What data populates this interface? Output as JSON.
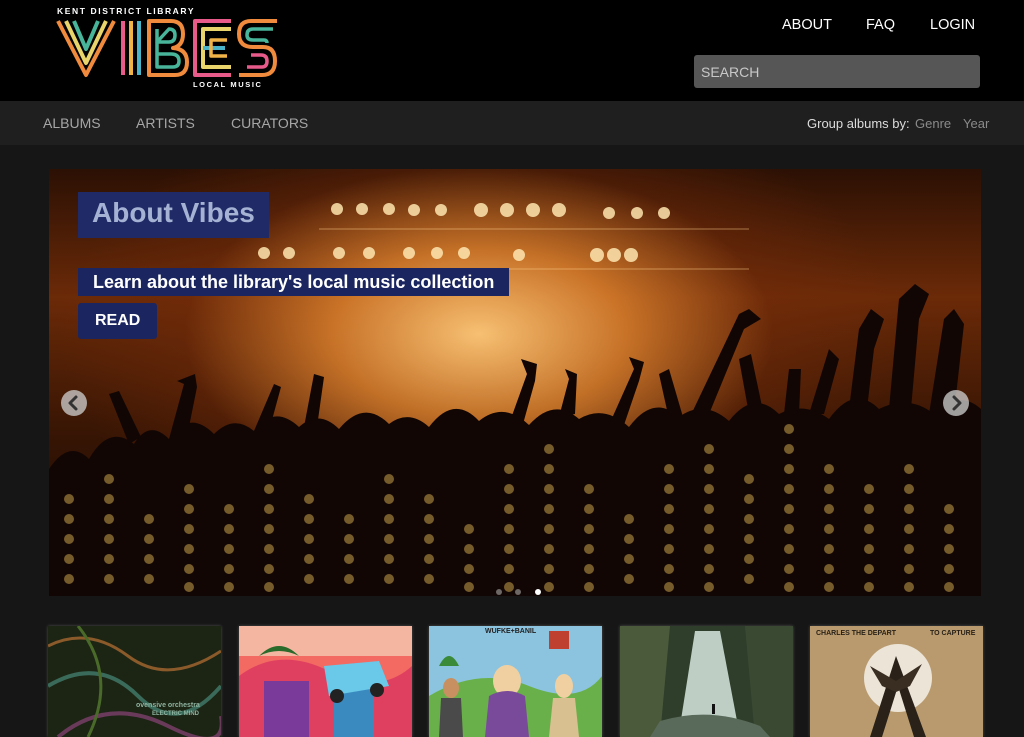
{
  "header": {
    "logo": {
      "top_text": "KENT DISTRICT LIBRARY",
      "main_text": "VIBES",
      "bottom_text": "LOCAL MUSIC"
    },
    "nav": [
      {
        "label": "ABOUT"
      },
      {
        "label": "FAQ"
      },
      {
        "label": "LOGIN"
      }
    ],
    "search": {
      "placeholder": "SEARCH",
      "value": ""
    }
  },
  "subnav": {
    "items": [
      {
        "label": "ALBUMS"
      },
      {
        "label": "ARTISTS"
      },
      {
        "label": "CURATORS"
      }
    ],
    "group_label": "Group albums by:",
    "group_options": [
      {
        "label": "Genre"
      },
      {
        "label": "Year"
      }
    ]
  },
  "hero": {
    "title": "About Vibes",
    "subtitle": "Learn about the library's local music collection",
    "button_label": "READ",
    "prev_icon": "chevron-left-icon",
    "next_icon": "chevron-right-icon",
    "slide_count": 3,
    "active_slide": 3
  },
  "albums": [
    {
      "artist": "ovensive orchestra",
      "title": "ELECTRIC MIND",
      "dominant_color": "#2e3a1e"
    },
    {
      "artist": "",
      "title": "",
      "dominant_color": "#e04060"
    },
    {
      "artist": "WUFKE+BANIL",
      "title": "",
      "dominant_color": "#7fb0d0"
    },
    {
      "artist": "",
      "title": "",
      "dominant_color": "#3f5a38"
    },
    {
      "artist": "CHARLES THE DEPART",
      "title": "TO CAPTURE",
      "dominant_color": "#b89a6e"
    }
  ],
  "colors": {
    "accent_navy": "#1b2560",
    "header_bg": "#000000",
    "page_bg": "#161616"
  }
}
